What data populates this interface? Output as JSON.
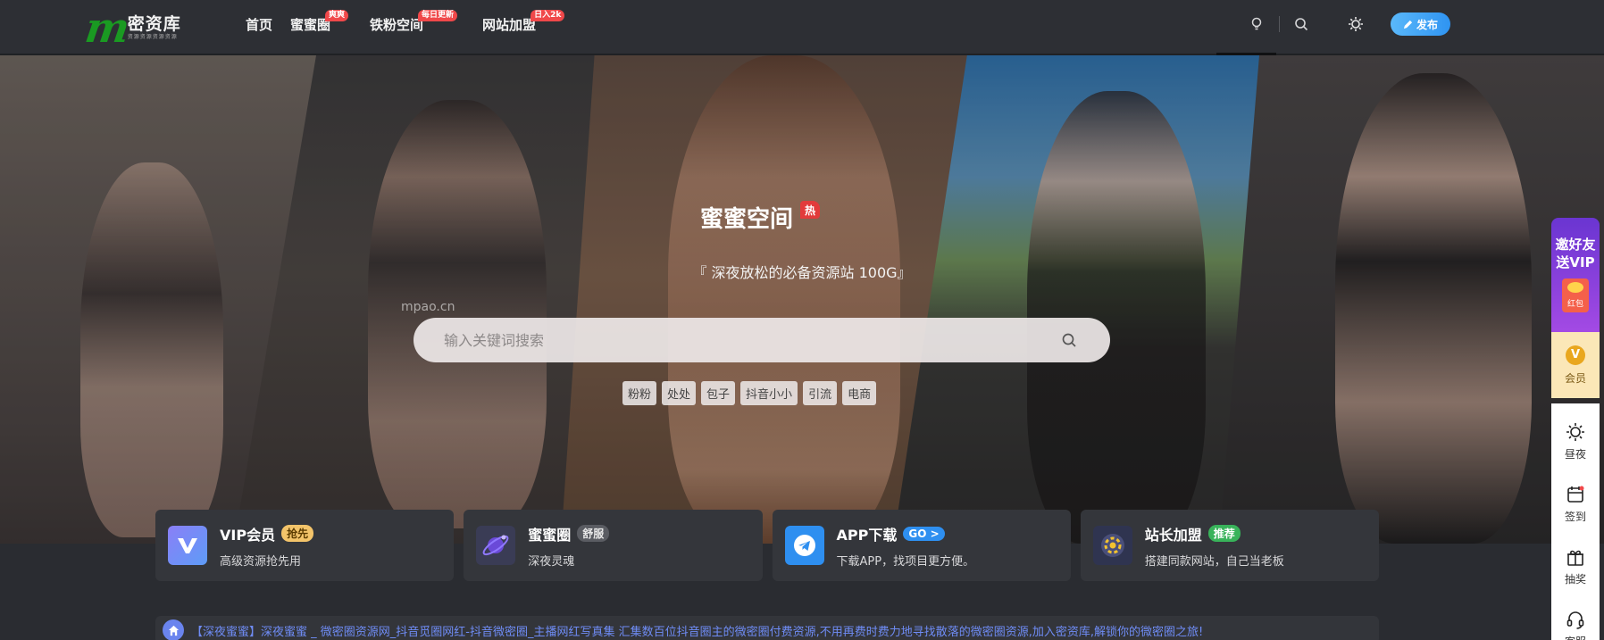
{
  "logo": {
    "mark": "m",
    "name": "密资库",
    "sub": "资源资源资源资源"
  },
  "nav": [
    {
      "label": "首页",
      "badge": ""
    },
    {
      "label": "蜜蜜圈",
      "badge": "爽爽"
    },
    {
      "label": "铁粉空间",
      "badge": "每日更新"
    },
    {
      "label": "网站加盟",
      "badge": "日入2k"
    }
  ],
  "header": {
    "publish_label": "发布"
  },
  "hero": {
    "title": "蜜蜜空间",
    "hot_tag": "热",
    "subtitle": "『 深夜放松的必备资源站 100G』",
    "watermark": "mpao.cn",
    "search_placeholder": "输入关键词搜索",
    "tags": [
      "粉粉",
      "处处",
      "包子",
      "抖音小小",
      "引流",
      "电商"
    ]
  },
  "cards": [
    {
      "title": "VIP会员",
      "badge": "抢先",
      "badge_color": "#f3c46a",
      "badge_text_color": "#5a3b00",
      "desc": "高级资源抢先用",
      "icon": "vip-icon"
    },
    {
      "title": "蜜蜜圈",
      "badge": "舒服",
      "badge_color": "#5a5c62",
      "badge_text_color": "#e8e8e8",
      "desc": "深夜灵魂",
      "icon": "planet-icon"
    },
    {
      "title": "APP下载",
      "badge": "GO >",
      "badge_color": "#2e8ff0",
      "badge_text_color": "#ffffff",
      "desc": "下载APP，找项目更方便。",
      "icon": "telegram-icon"
    },
    {
      "title": "站长加盟",
      "badge": "推荐",
      "badge_color": "#38b35a",
      "badge_text_color": "#ffffff",
      "desc": "搭建同款网站，自己当老板",
      "icon": "gear-badge-icon"
    }
  ],
  "marquee": {
    "text": "【深夜蜜蜜】深夜蜜蜜 _ 微密圈资源网_抖音觅圈网红-抖音微密圈_主播网红写真集 汇集数百位抖音圈主的微密圈付费资源,不用再费时费力地寻找散落的微密圈资源,加入密资库,解锁你的微密圈之旅!"
  },
  "sidebar": {
    "vip_text": "邀好友送VIP",
    "hongbao": "红包",
    "member_mark": "V",
    "member": "会员",
    "tools": [
      {
        "label": "昼夜",
        "icon": "sun-icon"
      },
      {
        "label": "签到",
        "icon": "calendar-icon"
      },
      {
        "label": "抽奖",
        "icon": "gift-icon"
      },
      {
        "label": "客服",
        "icon": "headset-icon"
      }
    ]
  },
  "colors": {
    "accent": "#2f94f2",
    "brand": "#1a9a22",
    "marquee": "#6f8cf5",
    "badge_red": "#f0484a"
  }
}
